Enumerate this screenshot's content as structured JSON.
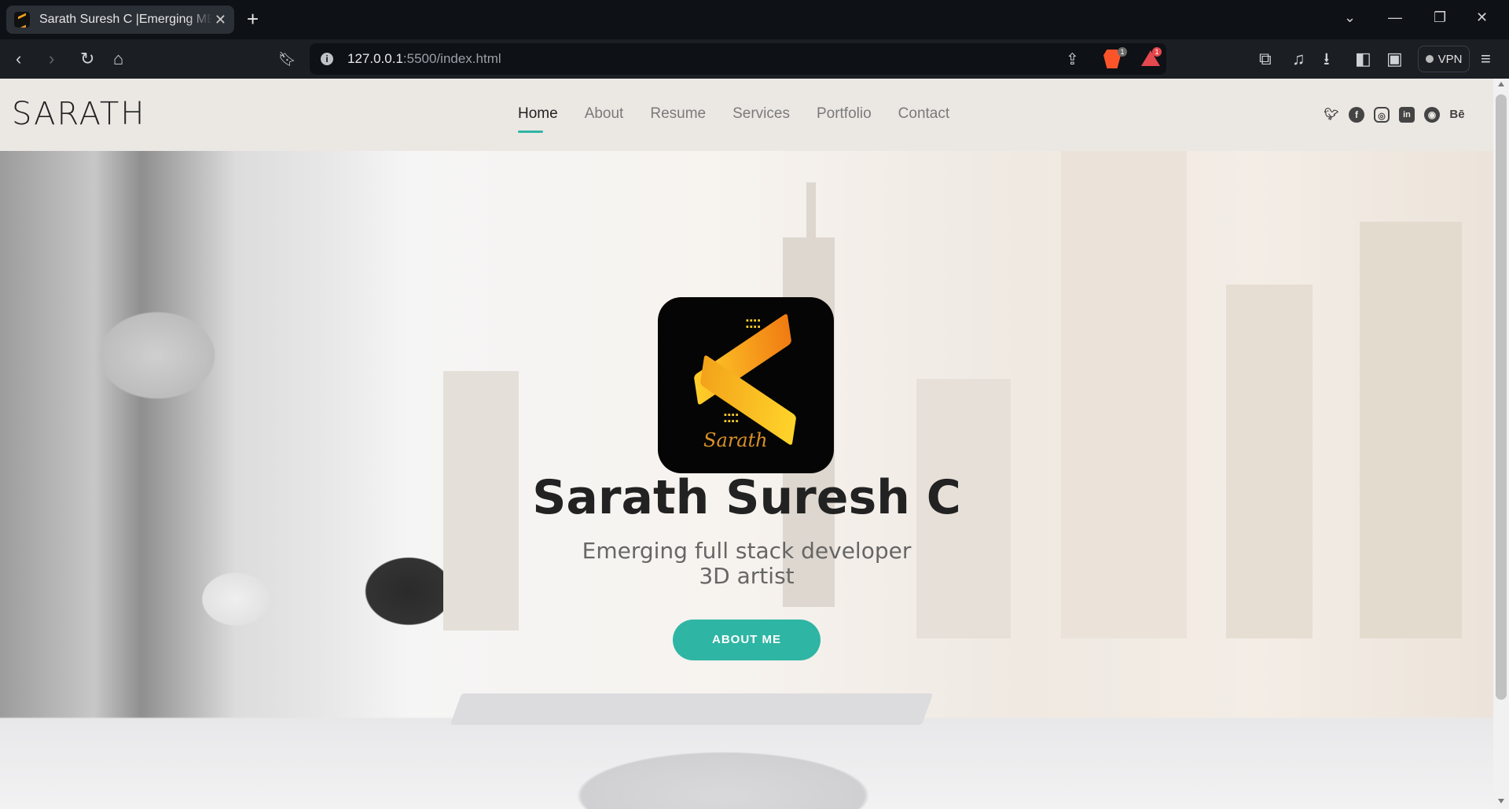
{
  "browser": {
    "tab_title": "Sarath Suresh C |Emerging MERN",
    "tab_close": "✕",
    "new_tab": "+",
    "url_host": "127.0.0.1",
    "url_rest": ":5500/index.html",
    "vpn_label": "VPN",
    "brave_badge": "1",
    "rewards_badge": "1"
  },
  "site": {
    "logo": "SARATH",
    "nav": [
      "Home",
      "About",
      "Resume",
      "Services",
      "Portfolio",
      "Contact"
    ],
    "active_nav": "Home",
    "social_icons": [
      "twitter-icon",
      "facebook-icon",
      "instagram-icon",
      "linkedin-icon",
      "github-icon",
      "behance-icon"
    ],
    "behance_text": "Bē",
    "logo_signature": "Sarath"
  },
  "hero": {
    "name": "Sarath Suresh C",
    "line1": "Emerging full stack developer",
    "line2": "3D artist",
    "button": "ABOUT ME"
  },
  "colors": {
    "accent": "#2fb5a4",
    "logo_orange": "#f3a21a"
  }
}
